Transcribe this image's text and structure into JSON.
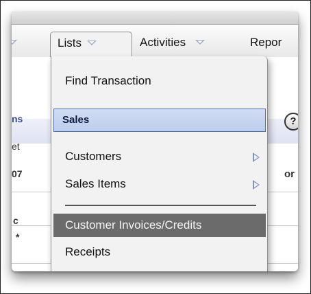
{
  "navbar": {
    "left_fragment_arrow": "",
    "tabs": [
      {
        "label": "Lists"
      },
      {
        "label": "Activities"
      },
      {
        "label": "Repor"
      }
    ]
  },
  "page_fragments": {
    "left": [
      "ns",
      "et",
      "07",
      "c",
      "*"
    ],
    "right": "or",
    "help": "?"
  },
  "menu": {
    "find_transaction": "Find Transaction",
    "section_header": "Sales",
    "items": [
      {
        "label": "Customers"
      },
      {
        "label": "Sales Items"
      }
    ],
    "selected_item": "Customer Invoices/Credits",
    "receipts": "Receipts"
  }
}
